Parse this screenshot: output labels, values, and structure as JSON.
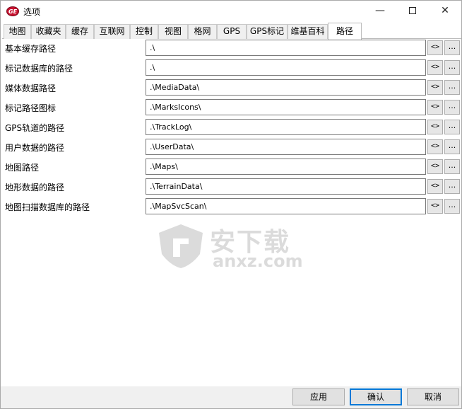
{
  "window": {
    "title": "选项",
    "controls": {
      "minimize": "—",
      "close": "✕"
    }
  },
  "tabs": [
    {
      "label": "地图"
    },
    {
      "label": "收藏夹"
    },
    {
      "label": "缓存"
    },
    {
      "label": "互联网"
    },
    {
      "label": "控制"
    },
    {
      "label": "视图"
    },
    {
      "label": "格网"
    },
    {
      "label": "GPS"
    },
    {
      "label": "GPS标记"
    },
    {
      "label": "维基百科"
    },
    {
      "label": "路径",
      "active": true
    }
  ],
  "paths": [
    {
      "label": "基本缓存路径",
      "value": ".\\"
    },
    {
      "label": "标记数据库的路径",
      "value": ".\\"
    },
    {
      "label": "媒体数据路径",
      "value": ".\\MediaData\\"
    },
    {
      "label": "标记路径图标",
      "value": ".\\MarksIcons\\"
    },
    {
      "label": "GPS轨道的路径",
      "value": ".\\TrackLog\\"
    },
    {
      "label": "用户数据的路径",
      "value": ".\\UserData\\"
    },
    {
      "label": "地图路径",
      "value": ".\\Maps\\"
    },
    {
      "label": "地形数据的路径",
      "value": ".\\TerrainData\\"
    },
    {
      "label": "地图扫描数据库的路径",
      "value": ".\\MapSvcScan\\"
    }
  ],
  "row_buttons": {
    "swap": "<>",
    "browse": "..."
  },
  "watermark": {
    "cn": "安下载",
    "en": "anxz.com"
  },
  "footer": {
    "apply": "应用",
    "ok": "确认",
    "cancel": "取消"
  },
  "colors": {
    "accent": "#0078d7",
    "app_icon": "#c8102e"
  }
}
